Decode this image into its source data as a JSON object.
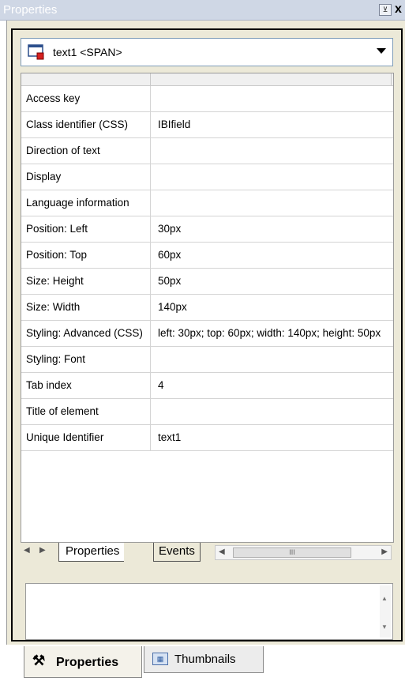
{
  "panel": {
    "title": "Properties",
    "pin_glyph": "⊻",
    "close_glyph": "x"
  },
  "selector": {
    "value": "text1 <SPAN>",
    "icon": "element-icon"
  },
  "grid": {
    "rows": [
      {
        "key": "Access key",
        "value": ""
      },
      {
        "key": "Class identifier (CSS)",
        "value": "IBIfield"
      },
      {
        "key": "Direction of text",
        "value": ""
      },
      {
        "key": "Display",
        "value": ""
      },
      {
        "key": "Language information",
        "value": ""
      },
      {
        "key": "Position: Left",
        "value": "30px"
      },
      {
        "key": "Position: Top",
        "value": "60px"
      },
      {
        "key": "Size: Height",
        "value": "50px"
      },
      {
        "key": "Size: Width",
        "value": "140px"
      },
      {
        "key": "Styling: Advanced (CSS)",
        "value": "left: 30px; top: 60px; width: 140px; height: 50px"
      },
      {
        "key": "Styling: Font",
        "value": ""
      },
      {
        "key": "Tab index",
        "value": "4"
      },
      {
        "key": "Title of element",
        "value": ""
      },
      {
        "key": "Unique Identifier",
        "value": "text1"
      }
    ]
  },
  "tabs": {
    "properties": "Properties",
    "events": "Events",
    "scroll_grip": "III"
  },
  "bottom_tabs": {
    "properties": "Properties",
    "thumbnails": "Thumbnails"
  }
}
